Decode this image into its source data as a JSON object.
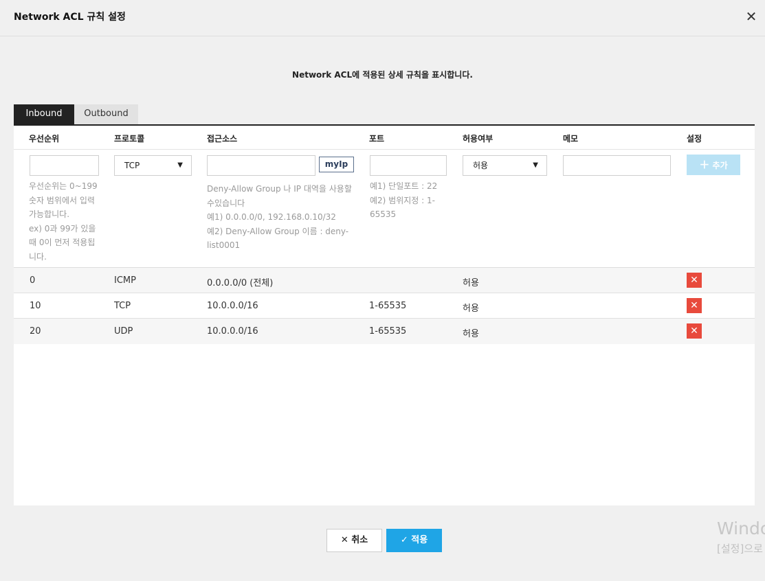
{
  "dialog": {
    "title": "Network ACL 규칙 설정",
    "close_icon": "close-icon"
  },
  "description": "Network ACL에 적용된 상세 규칙을 표시합니다.",
  "tabs": [
    {
      "label": "Inbound",
      "active": true
    },
    {
      "label": "Outbound",
      "active": false
    }
  ],
  "columns": {
    "priority": "우선순위",
    "protocol": "프로토콜",
    "source": "접근소스",
    "port": "포트",
    "allow": "허용여부",
    "memo": "메모",
    "settings": "설정"
  },
  "form": {
    "priority_value": "",
    "protocol_selected": "TCP",
    "source_value": "",
    "myip_label": "myIp",
    "port_value": "",
    "allow_selected": "허용",
    "memo_value": "",
    "add_label": "추가",
    "priority_hint": [
      "우선순위는 0~199",
      "숫자 범위에서 입력",
      "가능합니다.",
      "ex) 0과 99가 있을",
      "때 0이 먼저 적용됩",
      "니다."
    ],
    "source_hint": [
      "Deny-Allow Group 나 IP 대역을 사용할",
      "수있습니다",
      "예1) 0.0.0.0/0, 192.168.0.10/32",
      "예2) Deny-Allow Group 이름 : deny-",
      "list0001"
    ],
    "port_hint": [
      "예1) 단일포트 : 22",
      "예2) 범위지정 : 1-",
      "65535"
    ]
  },
  "rules": [
    {
      "priority": "0",
      "protocol": "ICMP",
      "source": "0.0.0.0/0 (전체)",
      "port": "",
      "allow": "허용"
    },
    {
      "priority": "10",
      "protocol": "TCP",
      "source": "10.0.0.0/16",
      "port": "1-65535",
      "allow": "허용"
    },
    {
      "priority": "20",
      "protocol": "UDP",
      "source": "10.0.0.0/16",
      "port": "1-65535",
      "allow": "허용"
    }
  ],
  "footer": {
    "cancel_label": "취소",
    "apply_label": "적용"
  },
  "watermark": {
    "line1": "Windo",
    "line2": "[설정]으로"
  },
  "colors": {
    "accent": "#1fa5e6",
    "delete": "#e84a3c",
    "tab_active": "#222222"
  }
}
